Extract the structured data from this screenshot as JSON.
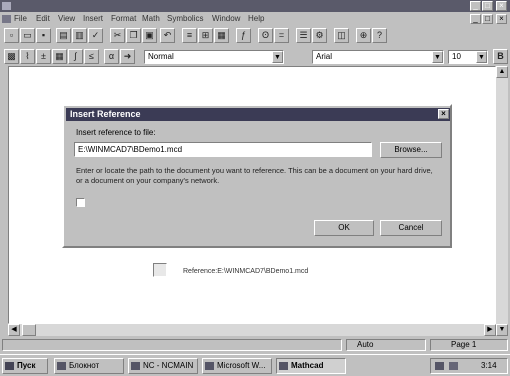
{
  "window": {
    "title": ""
  },
  "menu": [
    "File",
    "Edit",
    "View",
    "Insert",
    "Format",
    "Math",
    "Symbolics",
    "Window",
    "Help"
  ],
  "format_toolbar": {
    "style_value": "Normal",
    "font_value": "Arial",
    "size_value": "10"
  },
  "dialog": {
    "title": "Insert Reference",
    "prompt": "Insert reference to file:",
    "path_value": "E:\\WINMCAD7\\BDemo1.mcd",
    "browse_label": "Browse...",
    "description": "Enter or locate the path to the document you want to reference. This can be a document on your hard drive, or a document on your company's network.",
    "ok_label": "OK",
    "cancel_label": "Cancel"
  },
  "reference_label": "Reference:E:\\WINMCAD7\\BDemo1.mcd",
  "status": {
    "mode": "Auto",
    "page": "Page 1"
  },
  "taskbar": {
    "start_label": "Пуск",
    "tasks": [
      "Блокнот",
      "NC - NCMAIN",
      "Microsoft W...",
      "Mathcad"
    ],
    "clock": "3:14"
  }
}
